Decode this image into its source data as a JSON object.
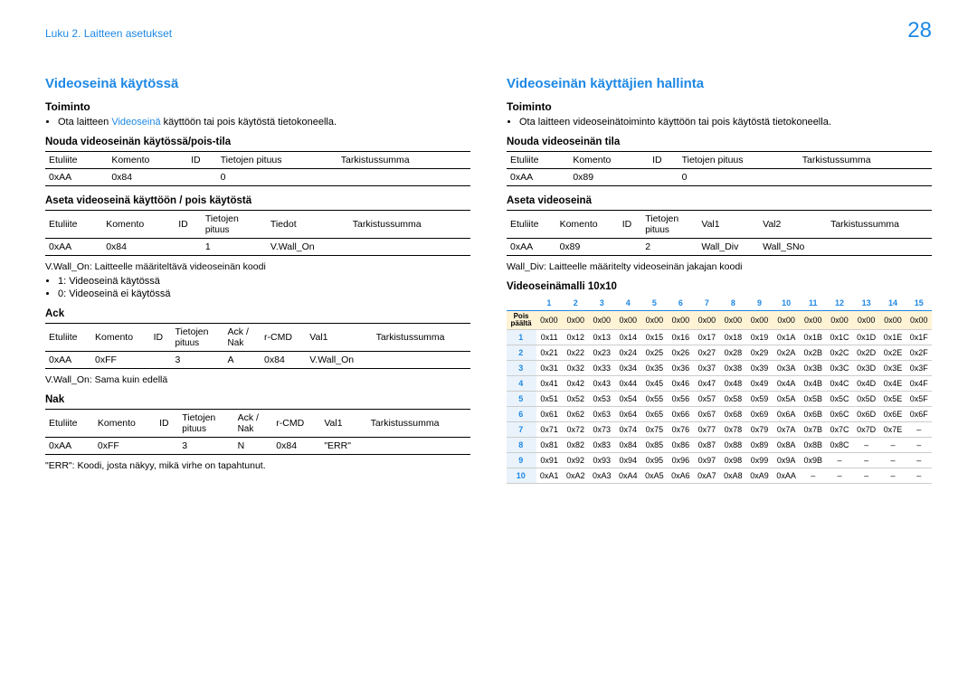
{
  "pageNumber": "28",
  "chapter": "Luku 2. Laitteen asetukset",
  "left": {
    "title": "Videoseinä käytössä",
    "funcHeading": "Toiminto",
    "funcBullet_pre": "Ota laitteen ",
    "funcBullet_blue": "Videoseinä",
    "funcBullet_post": " käyttöön tai pois käytöstä tietokoneella.",
    "getHeading": "Nouda videoseinän käytössä/pois-tila",
    "setHeading": "Aseta videoseinä käyttöön / pois käytöstä",
    "cols4": {
      "c1": "Etuliite",
      "c2": "Komento",
      "c3": "ID",
      "c4": "Tietojen pituus",
      "c5": "Tarkistussumma"
    },
    "row4": {
      "c1": "0xAA",
      "c2": "0x84",
      "c3": "",
      "c4": "0",
      "c5": ""
    },
    "cols5": {
      "c1": "Etuliite",
      "c2": "Komento",
      "c3": "ID",
      "c4a": "Tietojen",
      "c4b": "pituus",
      "c5": "Tiedot",
      "c6": "Tarkistussumma"
    },
    "row5": {
      "c1": "0xAA",
      "c2": "0x84",
      "c3": "",
      "c4": "1",
      "c5": "V.Wall_On",
      "c6": ""
    },
    "desc1": "V.Wall_On: Laitteelle määriteltävä videoseinän koodi",
    "opt1": "1: Videoseinä käytössä",
    "opt0": "0: Videoseinä ei käytössä",
    "ackHeading": "Ack",
    "ackCols": {
      "c1": "Etuliite",
      "c2": "Komento",
      "c3": "ID",
      "c4a": "Tietojen",
      "c4b": "pituus",
      "c5a": "Ack /",
      "c5b": "Nak",
      "c6": "r-CMD",
      "c7": "Val1",
      "c8": "Tarkistussumma"
    },
    "ackRow": {
      "c1": "0xAA",
      "c2": "0xFF",
      "c3": "",
      "c4": "3",
      "c5": "A",
      "c6": "0x84",
      "c7": "V.Wall_On",
      "c8": ""
    },
    "ackNote": "V.Wall_On: Sama kuin edellä",
    "nakHeading": "Nak",
    "nakRow": {
      "c1": "0xAA",
      "c2": "0xFF",
      "c3": "",
      "c4": "3",
      "c5": "N",
      "c6": "0x84",
      "c7": "\"ERR\"",
      "c8": ""
    },
    "errNote": "\"ERR\": Koodi, josta näkyy, mikä virhe on tapahtunut."
  },
  "right": {
    "title": "Videoseinän käyttäjien hallinta",
    "funcHeading": "Toiminto",
    "funcBullet": "Ota laitteen videoseinätoiminto käyttöön tai pois käytöstä tietokoneella.",
    "getHeading": "Nouda videoseinän tila",
    "cols4": {
      "c1": "Etuliite",
      "c2": "Komento",
      "c3": "ID",
      "c4": "Tietojen pituus",
      "c5": "Tarkistussumma"
    },
    "row4": {
      "c1": "0xAA",
      "c2": "0x89",
      "c3": "",
      "c4": "0",
      "c5": ""
    },
    "setHeading": "Aseta videoseinä",
    "cols6": {
      "c1": "Etuliite",
      "c2": "Komento",
      "c3": "ID",
      "c4a": "Tietojen",
      "c4b": "pituus",
      "c5": "Val1",
      "c6": "Val2",
      "c7": "Tarkistussumma"
    },
    "row6": {
      "c1": "0xAA",
      "c2": "0x89",
      "c3": "",
      "c4": "2",
      "c5": "Wall_Div",
      "c6": "Wall_SNo",
      "c7": ""
    },
    "desc1": "Wall_Div: Laitteelle määritelty videoseinän jakajan koodi",
    "modelHeading": "Videoseinämalli 10x10",
    "model": {
      "offLabelA": "Pois",
      "offLabelB": "päältä",
      "cols": [
        "1",
        "2",
        "3",
        "4",
        "5",
        "6",
        "7",
        "8",
        "9",
        "10",
        "11",
        "12",
        "13",
        "14",
        "15"
      ],
      "offRow": [
        "0x00",
        "0x00",
        "0x00",
        "0x00",
        "0x00",
        "0x00",
        "0x00",
        "0x00",
        "0x00",
        "0x00",
        "0x00",
        "0x00",
        "0x00",
        "0x00",
        "0x00"
      ],
      "rows": [
        {
          "h": "1",
          "v": [
            "0x11",
            "0x12",
            "0x13",
            "0x14",
            "0x15",
            "0x16",
            "0x17",
            "0x18",
            "0x19",
            "0x1A",
            "0x1B",
            "0x1C",
            "0x1D",
            "0x1E",
            "0x1F"
          ]
        },
        {
          "h": "2",
          "v": [
            "0x21",
            "0x22",
            "0x23",
            "0x24",
            "0x25",
            "0x26",
            "0x27",
            "0x28",
            "0x29",
            "0x2A",
            "0x2B",
            "0x2C",
            "0x2D",
            "0x2E",
            "0x2F"
          ]
        },
        {
          "h": "3",
          "v": [
            "0x31",
            "0x32",
            "0x33",
            "0x34",
            "0x35",
            "0x36",
            "0x37",
            "0x38",
            "0x39",
            "0x3A",
            "0x3B",
            "0x3C",
            "0x3D",
            "0x3E",
            "0x3F"
          ]
        },
        {
          "h": "4",
          "v": [
            "0x41",
            "0x42",
            "0x43",
            "0x44",
            "0x45",
            "0x46",
            "0x47",
            "0x48",
            "0x49",
            "0x4A",
            "0x4B",
            "0x4C",
            "0x4D",
            "0x4E",
            "0x4F"
          ]
        },
        {
          "h": "5",
          "v": [
            "0x51",
            "0x52",
            "0x53",
            "0x54",
            "0x55",
            "0x56",
            "0x57",
            "0x58",
            "0x59",
            "0x5A",
            "0x5B",
            "0x5C",
            "0x5D",
            "0x5E",
            "0x5F"
          ]
        },
        {
          "h": "6",
          "v": [
            "0x61",
            "0x62",
            "0x63",
            "0x64",
            "0x65",
            "0x66",
            "0x67",
            "0x68",
            "0x69",
            "0x6A",
            "0x6B",
            "0x6C",
            "0x6D",
            "0x6E",
            "0x6F"
          ]
        },
        {
          "h": "7",
          "v": [
            "0x71",
            "0x72",
            "0x73",
            "0x74",
            "0x75",
            "0x76",
            "0x77",
            "0x78",
            "0x79",
            "0x7A",
            "0x7B",
            "0x7C",
            "0x7D",
            "0x7E",
            "–"
          ]
        },
        {
          "h": "8",
          "v": [
            "0x81",
            "0x82",
            "0x83",
            "0x84",
            "0x85",
            "0x86",
            "0x87",
            "0x88",
            "0x89",
            "0x8A",
            "0x8B",
            "0x8C",
            "–",
            "–",
            "–"
          ]
        },
        {
          "h": "9",
          "v": [
            "0x91",
            "0x92",
            "0x93",
            "0x94",
            "0x95",
            "0x96",
            "0x97",
            "0x98",
            "0x99",
            "0x9A",
            "0x9B",
            "–",
            "–",
            "–",
            "–"
          ]
        },
        {
          "h": "10",
          "v": [
            "0xA1",
            "0xA2",
            "0xA3",
            "0xA4",
            "0xA5",
            "0xA6",
            "0xA7",
            "0xA8",
            "0xA9",
            "0xAA",
            "–",
            "–",
            "–",
            "–",
            "–"
          ]
        }
      ]
    }
  }
}
